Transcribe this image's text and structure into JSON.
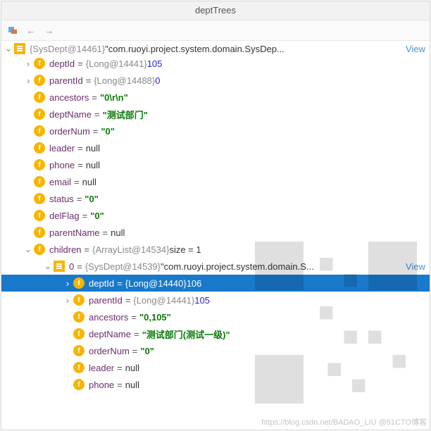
{
  "title": "deptTrees",
  "toolbar": {
    "nav_back": "←",
    "nav_fwd": "→"
  },
  "view_label": "View",
  "truncated_top": {
    "obj": "{SysDept@14461}",
    "text": "\"com.ruoyi.project.system.domain.SysDep..."
  },
  "items": [
    {
      "depth": 2,
      "expand": "right",
      "icon": "f",
      "name": "deptId",
      "op": "=",
      "obj": "{Long@14441}",
      "value": "105",
      "vtype": "num"
    },
    {
      "depth": 2,
      "expand": "right",
      "icon": "f",
      "name": "parentId",
      "op": "=",
      "obj": "{Long@14488}",
      "value": "0",
      "vtype": "num"
    },
    {
      "depth": 2,
      "expand": "none",
      "icon": "f",
      "name": "ancestors",
      "op": "=",
      "value": "\"0\\r\\n\"",
      "vtype": "str"
    },
    {
      "depth": 2,
      "expand": "none",
      "icon": "f",
      "name": "deptName",
      "op": "=",
      "value": "\"测试部门\"",
      "vtype": "str"
    },
    {
      "depth": 2,
      "expand": "none",
      "icon": "f",
      "name": "orderNum",
      "op": "=",
      "value": "\"0\"",
      "vtype": "str"
    },
    {
      "depth": 2,
      "expand": "none",
      "icon": "f",
      "name": "leader",
      "op": "=",
      "value": "null",
      "vtype": "plain"
    },
    {
      "depth": 2,
      "expand": "none",
      "icon": "f",
      "name": "phone",
      "op": "=",
      "value": "null",
      "vtype": "plain"
    },
    {
      "depth": 2,
      "expand": "none",
      "icon": "f",
      "name": "email",
      "op": "=",
      "value": "null",
      "vtype": "plain"
    },
    {
      "depth": 2,
      "expand": "none",
      "icon": "f",
      "name": "status",
      "op": "=",
      "value": "\"0\"",
      "vtype": "str"
    },
    {
      "depth": 2,
      "expand": "none",
      "icon": "f",
      "name": "delFlag",
      "op": "=",
      "value": "\"0\"",
      "vtype": "str"
    },
    {
      "depth": 2,
      "expand": "none",
      "icon": "f",
      "name": "parentName",
      "op": "=",
      "value": "null",
      "vtype": "plain"
    },
    {
      "depth": 2,
      "expand": "down",
      "icon": "f",
      "name": "children",
      "op": "=",
      "obj": "{ArrayList@14534}",
      "tail": " size = 1"
    },
    {
      "depth": 3,
      "expand": "down",
      "icon": "list",
      "name": "0",
      "op": "=",
      "obj": "{SysDept@14539}",
      "value": "\"com.ruoyi.project.system.domain.S...",
      "vtype": "str_plain",
      "view": true
    },
    {
      "depth": 4,
      "expand": "right",
      "icon": "f",
      "name": "deptId",
      "op": "=",
      "obj": "{Long@14440}",
      "value": "106",
      "vtype": "num",
      "selected": true
    },
    {
      "depth": 4,
      "expand": "right",
      "icon": "f",
      "name": "parentId",
      "op": "=",
      "obj": "{Long@14441}",
      "value": "105",
      "vtype": "num"
    },
    {
      "depth": 4,
      "expand": "none",
      "icon": "f",
      "name": "ancestors",
      "op": "=",
      "value": "\"0,105\"",
      "vtype": "str"
    },
    {
      "depth": 4,
      "expand": "none",
      "icon": "f",
      "name": "deptName",
      "op": "=",
      "value": "\"测试部门(测试一级)\"",
      "vtype": "str"
    },
    {
      "depth": 4,
      "expand": "none",
      "icon": "f",
      "name": "orderNum",
      "op": "=",
      "value": "\"0\"",
      "vtype": "str"
    },
    {
      "depth": 4,
      "expand": "none",
      "icon": "f",
      "name": "leader",
      "op": "=",
      "value": "null",
      "vtype": "plain"
    },
    {
      "depth": 4,
      "expand": "none",
      "icon": "f",
      "name": "phone",
      "op": "=",
      "value": "null",
      "vtype": "plain"
    }
  ],
  "watermark": "https://blog.csdn.net/BADAO_LIU @51CTO博客"
}
